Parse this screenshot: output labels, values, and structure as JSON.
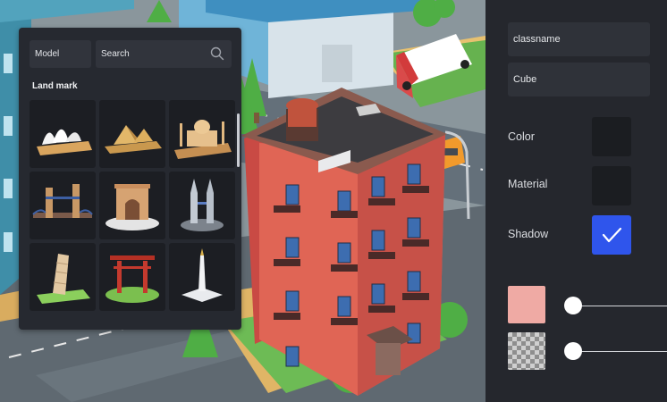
{
  "library": {
    "model_label": "Model",
    "search_placeholder": "Search",
    "section_title": "Land mark",
    "items": [
      {
        "name": "sydney-opera-house-model"
      },
      {
        "name": "pyramids-model"
      },
      {
        "name": "taj-mahal-model"
      },
      {
        "name": "tower-bridge-model"
      },
      {
        "name": "arc-de-triomphe-model"
      },
      {
        "name": "petronas-towers-model"
      },
      {
        "name": "leaning-tower-of-pisa-model"
      },
      {
        "name": "torii-gate-model"
      },
      {
        "name": "obelisk-monument-model"
      }
    ]
  },
  "properties": {
    "classname_value": "classname",
    "shape_value": "Cube",
    "color_label": "Color",
    "material_label": "Material",
    "shadow_label": "Shadow",
    "shadow_checked": true,
    "color_chip": "#efaaa4",
    "accent": "#2f55ec"
  },
  "icons": [
    "search-icon",
    "checkmark-icon"
  ]
}
